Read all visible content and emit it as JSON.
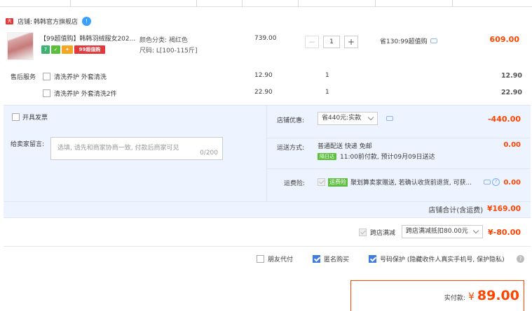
{
  "store": {
    "prefix": "店铺:",
    "name": "韩韩官方旗舰店",
    "tmall_badge": "tmall",
    "shop_badge": "!"
  },
  "item": {
    "title": "【99超值购】韩韩羽绒服女202...",
    "sku_color": "颜色分类: 褐红色",
    "sku_size": "尺码: L[100-115斤]",
    "unit_price": "739.00",
    "quantity": "1",
    "qty_minus": "−",
    "qty_plus": "+",
    "saving": "省130:99超值购",
    "subtotal": "609.00",
    "badges": [
      {
        "text": "7",
        "color": "#3cb371"
      },
      {
        "text": "✓",
        "color": "#5bbf3b"
      },
      {
        "text": "✦",
        "color": "#f5a623"
      },
      {
        "text": "99超值购",
        "color": "#e4393c"
      }
    ]
  },
  "services": {
    "label": "售后服务",
    "rows": [
      {
        "name": "清洗养护 外套清洗",
        "price": "12.90",
        "qty": "1",
        "subtotal": "12.90"
      },
      {
        "name": "清洗养护 外套清洗2件",
        "price": "22.90",
        "qty": "1",
        "subtotal": "22.90"
      }
    ]
  },
  "invoice": {
    "label": "开具发票"
  },
  "memo": {
    "label": "给卖家留言:",
    "placeholder": "选填, 请先和商家协商一致, 付款后商家可见",
    "counter": "0/200"
  },
  "discount": {
    "label": "店铺优惠:",
    "selected": "省440元:实款",
    "amount": "-440.00"
  },
  "shipping": {
    "label": "运送方式:",
    "method": "普通配送 快递 免邮",
    "tag": "隔日达",
    "eta": "11:00前付款, 预计09月09日送达",
    "amount": "0.00"
  },
  "insurance": {
    "label": "运费险:",
    "tag": "运费险",
    "text": "聚划算卖家赠送, 若确认收货前退货, 可获...",
    "amount": "0.00"
  },
  "store_total": {
    "label": "店铺合计(含运费)",
    "amount": "¥169.00"
  },
  "cross_discount": {
    "label": "跨店满减",
    "selected": "跨店满减抵扣80.00元",
    "amount": "¥-80.00"
  },
  "options": {
    "friend_pay": "朋友代付",
    "anonymous": "匿名购买",
    "privacy": "号码保护 (隐藏收件人真实手机号, 保护隐私)"
  },
  "final": {
    "label": "实付款:",
    "currency": "¥",
    "amount": "89.00"
  },
  "colors": {
    "accent": "#ff4400",
    "panel": "#eef4ff",
    "check": "#3e7ce0"
  }
}
